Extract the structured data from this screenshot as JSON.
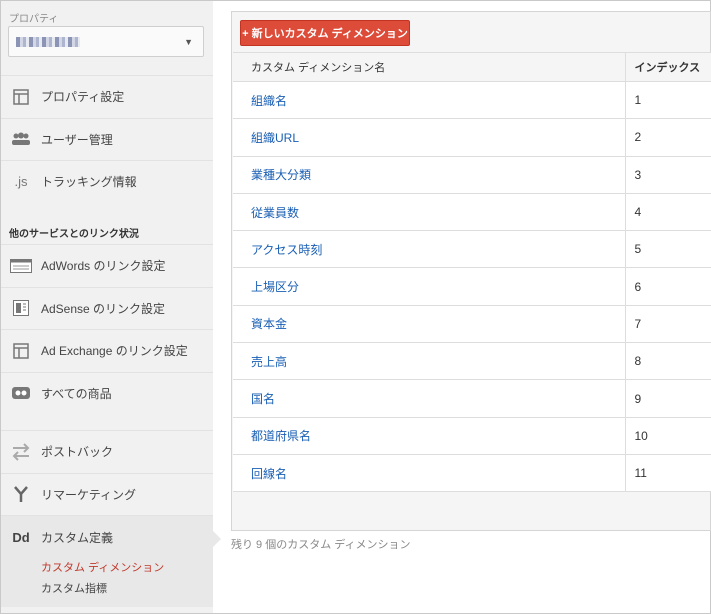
{
  "sidebar": {
    "property_label": "プロパティ",
    "items": [
      {
        "name": "nav-property-settings",
        "icon": "window-icon",
        "label": "プロパティ設定"
      },
      {
        "name": "nav-user-management",
        "icon": "users-icon",
        "label": "ユーザー管理"
      },
      {
        "name": "nav-tracking-info",
        "icon": "js-icon",
        "label": "トラッキング情報"
      }
    ],
    "linked_section_title": "他のサービスとのリンク状況",
    "linked_items": [
      {
        "name": "nav-adwords-link",
        "icon": "adwords-icon",
        "label": "AdWords のリンク設定"
      },
      {
        "name": "nav-adsense-link",
        "icon": "adsense-icon",
        "label": "AdSense のリンク設定"
      },
      {
        "name": "nav-adexchange-link",
        "icon": "adexchange-icon",
        "label": "Ad Exchange のリンク設定"
      },
      {
        "name": "nav-all-products",
        "icon": "link-icon",
        "label": "すべての商品"
      }
    ],
    "more_items": [
      {
        "name": "nav-postback",
        "icon": "swap-icon",
        "label": "ポストバック"
      },
      {
        "name": "nav-remarketing",
        "icon": "fork-icon",
        "label": "リマーケティング"
      }
    ],
    "custom_group": {
      "icon_text": "Dd",
      "label": "カスタム定義",
      "sub_items": [
        "カスタム ディメンション",
        "カスタム指標"
      ]
    }
  },
  "main": {
    "new_button_label": "+ 新しいカスタム ディメンション",
    "columns": [
      "カスタム ディメンション名",
      "インデックス"
    ],
    "rows": [
      {
        "name": "組織名",
        "index": "1"
      },
      {
        "name": "組織URL",
        "index": "2"
      },
      {
        "name": "業種大分類",
        "index": "3"
      },
      {
        "name": "従業員数",
        "index": "4"
      },
      {
        "name": "アクセス時刻",
        "index": "5"
      },
      {
        "name": "上場区分",
        "index": "6"
      },
      {
        "name": "資本金",
        "index": "7"
      },
      {
        "name": "売上高",
        "index": "8"
      },
      {
        "name": "国名",
        "index": "9"
      },
      {
        "name": "都道府県名",
        "index": "10"
      },
      {
        "name": "回線名",
        "index": "11"
      }
    ],
    "remaining_text": "残り 9 個のカスタム ディメンション"
  },
  "colors": {
    "accent_red": "#dd4b39",
    "link_blue": "#1a5fb4",
    "active_sub": "#c0392b"
  }
}
